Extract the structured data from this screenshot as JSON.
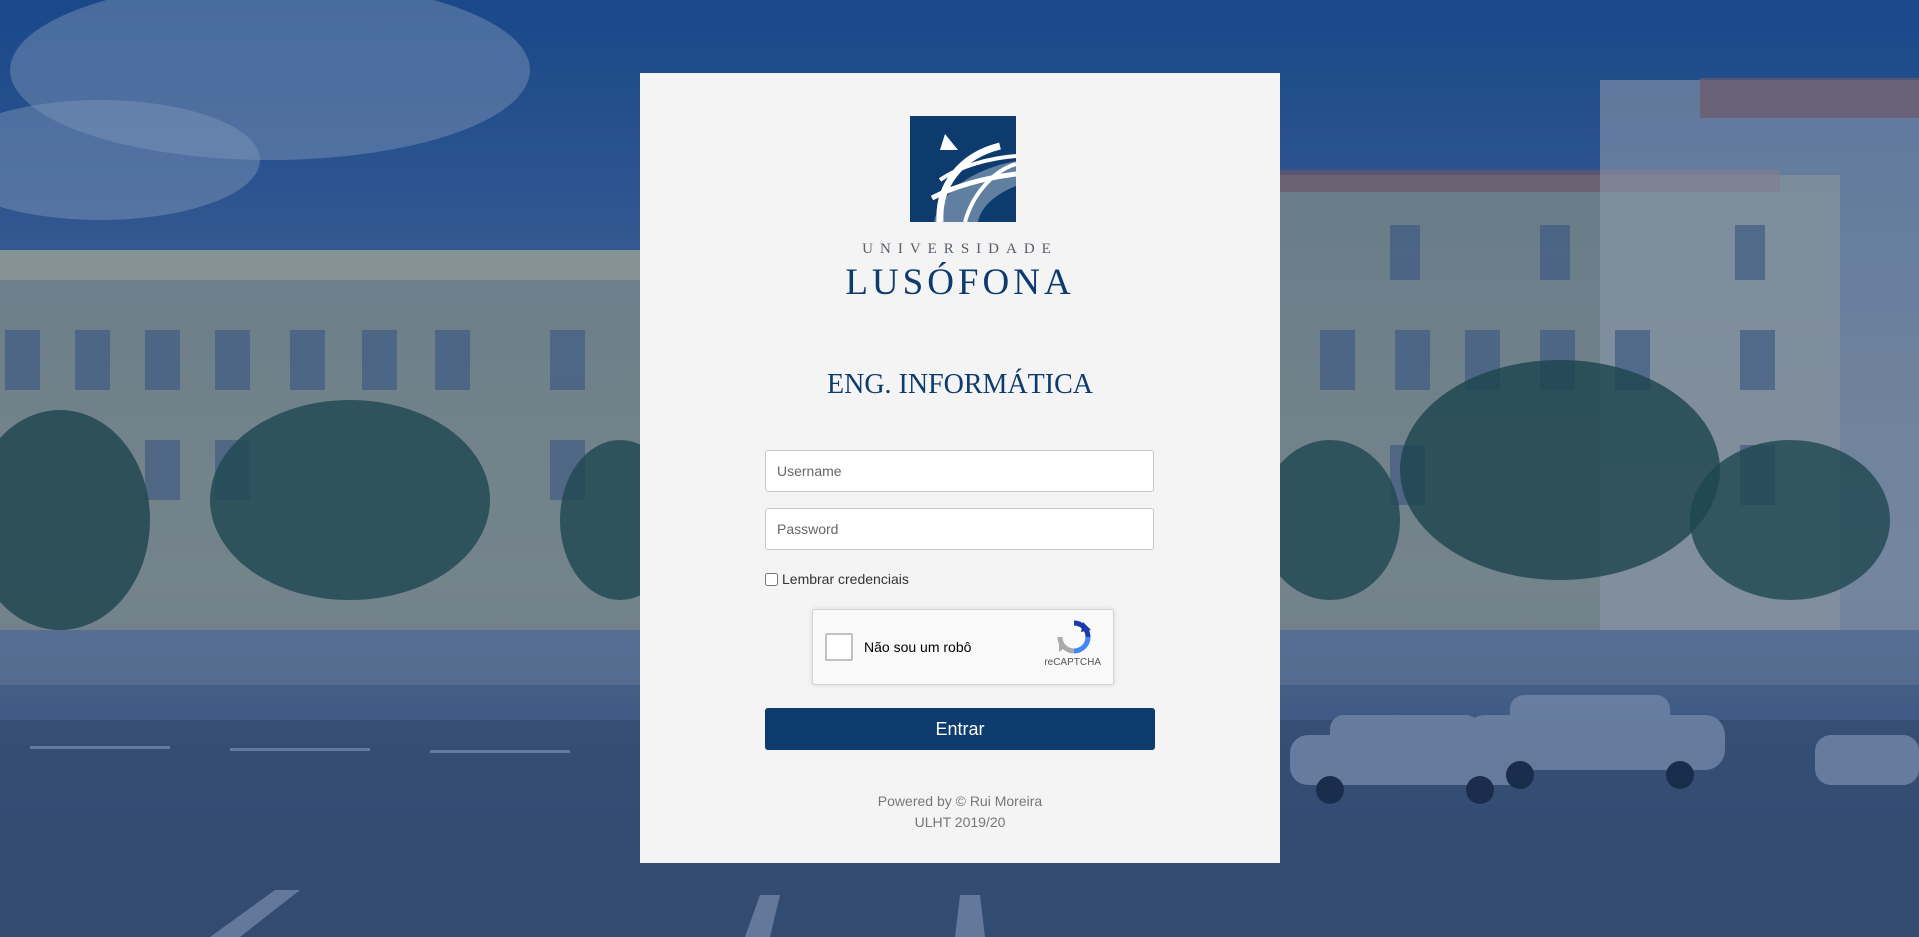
{
  "brand": {
    "small": "UNIVERSIDADE",
    "big": "LUSÓFONA"
  },
  "course": "ENG. INFORMÁTICA",
  "form": {
    "username_placeholder": "Username",
    "password_placeholder": "Password",
    "remember_label": "Lembrar credenciais",
    "submit_label": "Entrar"
  },
  "captcha": {
    "label": "Não sou um robô",
    "brand": "reCAPTCHA"
  },
  "footer": {
    "line1": "Powered by © Rui Moreira",
    "line2": "ULHT 2019/20"
  },
  "colors": {
    "primary": "#0d3b6e",
    "panel": "#f4f4f4",
    "overlay": "#123c7d"
  },
  "icons": {
    "logo": "globe-logo-icon",
    "captcha": "recaptcha-icon"
  }
}
